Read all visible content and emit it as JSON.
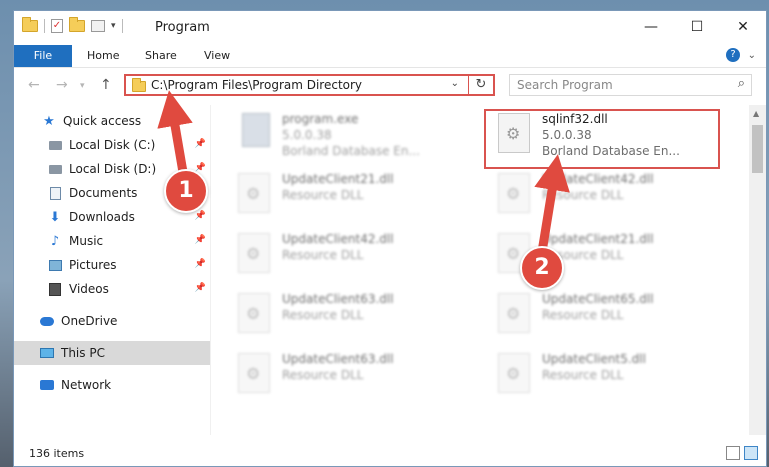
{
  "window": {
    "title": "Program",
    "minimize": "—",
    "maximize": "☐",
    "close": "✕"
  },
  "ribbon": {
    "file": "File",
    "home": "Home",
    "share": "Share",
    "view": "View"
  },
  "nav": {
    "address": "C:\\Program Files\\Program Directory",
    "search_placeholder": "Search Program"
  },
  "sidebar": {
    "items": [
      {
        "label": "Quick access"
      },
      {
        "label": "Local Disk (C:)"
      },
      {
        "label": "Local Disk (D:)"
      },
      {
        "label": "Documents"
      },
      {
        "label": "Downloads"
      },
      {
        "label": "Music"
      },
      {
        "label": "Pictures"
      },
      {
        "label": "Videos"
      },
      {
        "label": "OneDrive"
      },
      {
        "label": "This PC"
      },
      {
        "label": "Network"
      }
    ]
  },
  "files": [
    {
      "name": "program.exe",
      "version": "5.0.0.38",
      "description": "Borland Database En..."
    },
    {
      "name": "sqlinf32.dll",
      "version": "5.0.0.38",
      "description": "Borland Database En..."
    },
    {
      "name": "UpdateClient21.dll",
      "description": "Resource DLL"
    },
    {
      "name": "UpdateClient42.dll",
      "description": "Resource DLL"
    },
    {
      "name": "UpdateClient42.dll",
      "description": "Resource DLL"
    },
    {
      "name": "UpdateClient21.dll",
      "description": "Resource DLL"
    },
    {
      "name": "UpdateClient63.dll",
      "description": "Resource DLL"
    },
    {
      "name": "UpdateClient65.dll",
      "description": "Resource DLL"
    },
    {
      "name": "UpdateClient63.dll",
      "description": "Resource DLL"
    },
    {
      "name": "UpdateClient5.dll",
      "description": "Resource DLL"
    }
  ],
  "status": {
    "count": "136 items"
  },
  "annotations": {
    "step1": "1",
    "step2": "2",
    "color": "#e04a3f"
  }
}
